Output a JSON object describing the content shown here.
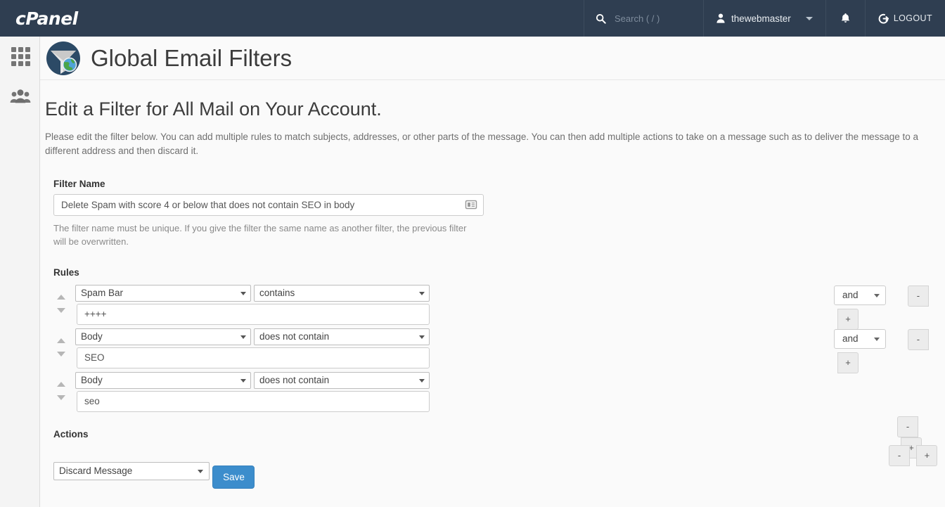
{
  "header": {
    "brand": "cPanel",
    "search_placeholder": "Search ( / )",
    "search_icon": "search-icon",
    "user_name": "thewebmaster",
    "user_icon": "user-icon",
    "caret_icon": "chevron-down-icon",
    "bell_icon": "bell-icon",
    "logout_label": "LOGOUT",
    "logout_icon": "logout-icon",
    "background_color": "#2f3e51"
  },
  "sidebar": {
    "items": [
      {
        "name": "apps-grid",
        "icon": "grid-icon"
      },
      {
        "name": "user-manager",
        "icon": "users-icon"
      }
    ]
  },
  "page": {
    "title": "Global Email Filters",
    "title_icon": "funnel-globe-icon",
    "heading": "Edit a Filter for All Mail on Your Account.",
    "description": "Please edit the filter below. You can add multiple rules to match subjects, addresses, or other parts of the message. You can then add multiple actions to take on a message such as to deliver the message to a different address and then discard it."
  },
  "filter_name": {
    "label": "Filter Name",
    "value": "Delete Spam with score 4 or below that does not contain SEO in body",
    "icon": "form-list-icon",
    "hint": "The filter name must be unique. If you give the filter the same name as another filter, the previous filter will be overwritten."
  },
  "rules": {
    "label": "Rules",
    "rows": [
      {
        "field": "Spam Bar",
        "operator": "contains",
        "value": "++++",
        "conjunction": "and",
        "has_conjunction": true,
        "minus_label": "-",
        "plus_label": "+"
      },
      {
        "field": "Body",
        "operator": "does not contain",
        "value": "SEO",
        "conjunction": "and",
        "has_conjunction": true,
        "minus_label": "-",
        "plus_label": "+"
      },
      {
        "field": "Body",
        "operator": "does not contain",
        "value": "seo",
        "conjunction": "",
        "has_conjunction": false,
        "minus_label": "-",
        "plus_label": "+"
      }
    ]
  },
  "actions": {
    "label": "Actions",
    "value": "Discard Message",
    "minus_label": "-",
    "plus_label": "+"
  },
  "save": {
    "label": "Save",
    "color": "#3c8dcc"
  }
}
